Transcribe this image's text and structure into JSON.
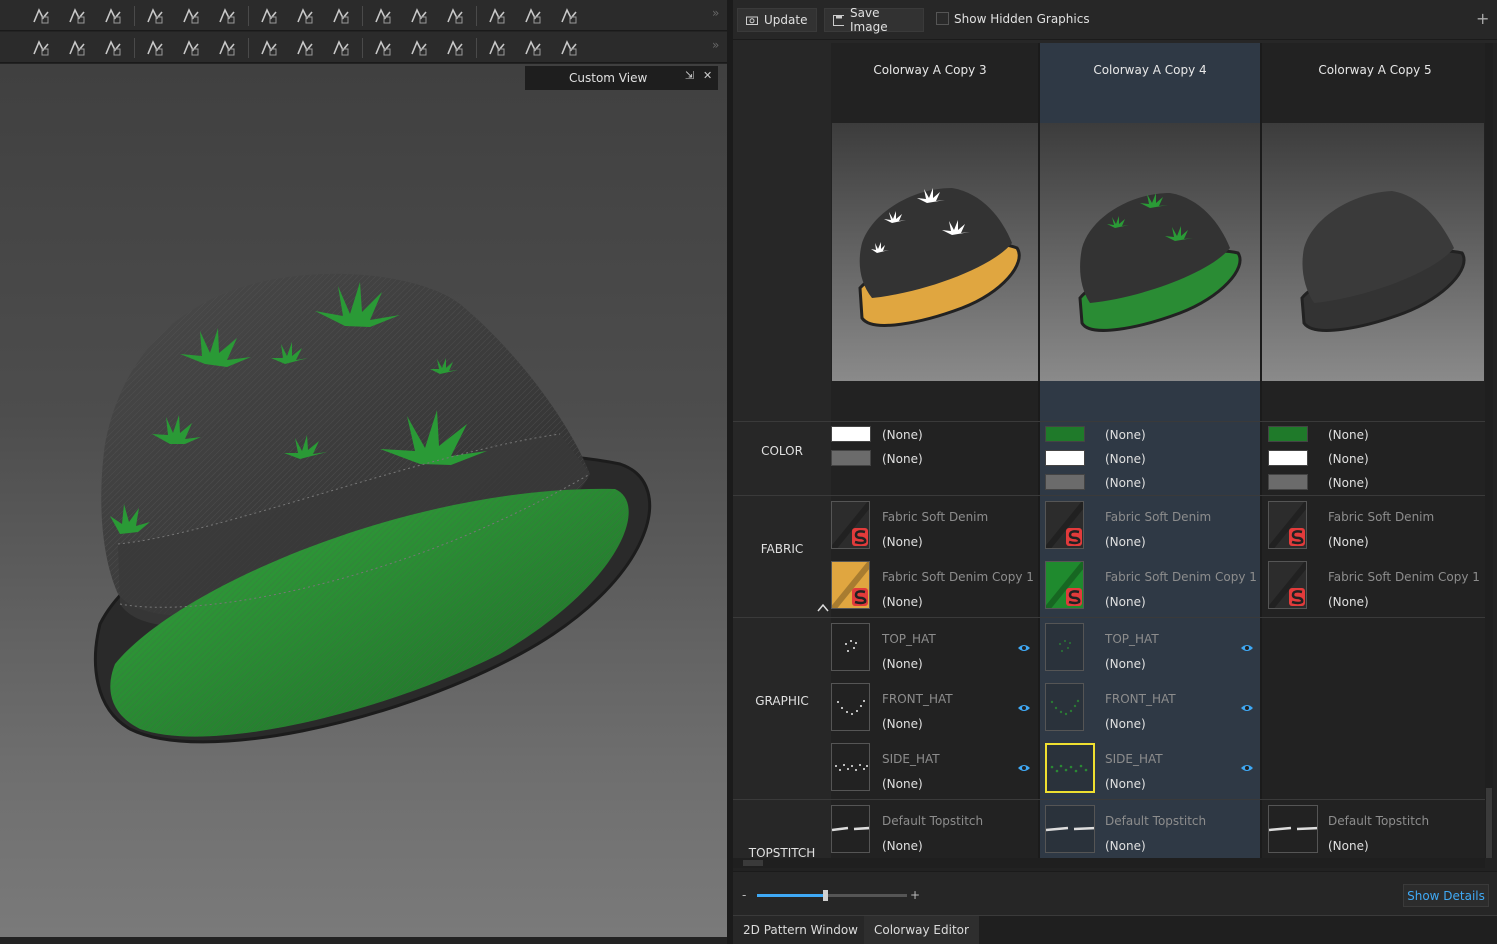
{
  "toolbar": {
    "row1_icons": [
      "select-mesh-icon",
      "transform-icon",
      "simulate-garment-icon",
      "sewing-segment-icon",
      "sewing-free-icon",
      "sewing-multi-icon",
      "tack-icon",
      "pin-icon",
      "brush-icon",
      "fold-arrange-icon",
      "fold-icon",
      "avatar-arrange-icon",
      "arrange-point-icon",
      "arrange-bar-icon",
      "avatar-select-icon"
    ],
    "row2_icons": [
      "edit-pattern-icon",
      "edit-curve-icon",
      "edit-point-icon",
      "segment-sewing-icon",
      "free-sewing-icon",
      "fold-tool-icon",
      "topstitch-icon",
      "pipe-icon",
      "button-icon",
      "buttonhole-icon",
      "zipper-icon",
      "puckering-icon",
      "shirring-icon",
      "texture-edit-icon",
      "texture-transform-icon"
    ],
    "more_glyph": "»"
  },
  "viewport": {
    "title": "Custom View",
    "dock_glyph": "⇲",
    "close_glyph": "✕"
  },
  "panel_toolbar": {
    "update_label": "Update",
    "save_image_label": "Save Image",
    "show_hidden_label": "Show Hidden Graphics",
    "show_hidden_checked": false,
    "add_glyph": "+"
  },
  "colorways": [
    {
      "name": "Colorway A Copy 3",
      "selected": false,
      "color_swatches": [
        {
          "hex": "#ffffff",
          "label": "(None)"
        },
        {
          "hex": "#6b6b6b",
          "label": "(None)"
        }
      ],
      "fabrics": [
        {
          "name": "Fabric Soft Denim",
          "value": "(None)",
          "hex": "#2c2c2c"
        },
        {
          "name": "Fabric Soft Denim Copy 1",
          "value": "(None)",
          "hex": "#e0a640"
        }
      ],
      "graphics": [
        {
          "name": "TOP_HAT",
          "value": "(None)"
        },
        {
          "name": "FRONT_HAT",
          "value": "(None)"
        },
        {
          "name": "SIDE_HAT",
          "value": "(None)"
        }
      ],
      "topstitch": {
        "name": "Default Topstitch",
        "value": "(None)"
      },
      "leaf_hex": "#ffffff",
      "lining_hex": "#e0a640"
    },
    {
      "name": "Colorway A Copy 4",
      "selected": true,
      "color_swatches": [
        {
          "hex": "#1f7a2a",
          "label": "(None)"
        },
        {
          "hex": "#ffffff",
          "label": "(None)"
        },
        {
          "hex": "#6b6b6b",
          "label": "(None)"
        }
      ],
      "fabrics": [
        {
          "name": "Fabric Soft Denim",
          "value": "(None)",
          "hex": "#2c2c2c"
        },
        {
          "name": "Fabric Soft Denim Copy 1",
          "value": "(None)",
          "hex": "#1f8a2e"
        }
      ],
      "graphics": [
        {
          "name": "TOP_HAT",
          "value": "(None)"
        },
        {
          "name": "FRONT_HAT",
          "value": "(None)"
        },
        {
          "name": "SIDE_HAT",
          "value": "(None)"
        }
      ],
      "topstitch": {
        "name": "Default Topstitch",
        "value": "(None)"
      },
      "leaf_hex": "#2a9a36",
      "lining_hex": "#2a8c34"
    },
    {
      "name": "Colorway A Copy 5",
      "selected": false,
      "color_swatches": [
        {
          "hex": "#1f7a2a",
          "label": "(None)"
        },
        {
          "hex": "#ffffff",
          "label": "(None)"
        },
        {
          "hex": "#6b6b6b",
          "label": "(None)"
        }
      ],
      "fabrics": [
        {
          "name": "Fabric Soft Denim",
          "value": "(None)",
          "hex": "#2c2c2c"
        },
        {
          "name": "Fabric Soft Denim Copy 1",
          "value": "(None)",
          "hex": "#2c2c2c"
        }
      ],
      "graphics": [],
      "topstitch": {
        "name": "Default Topstitch",
        "value": "(None)"
      },
      "leaf_hex": "#333333",
      "lining_hex": "#333333"
    }
  ],
  "row_labels": {
    "color": "COLOR",
    "fabric": "FABRIC",
    "graphic": "GRAPHIC",
    "topstitch": "TOPSTITCH"
  },
  "zoom_slider": {
    "minus": "-",
    "plus": "+",
    "value": 0.45
  },
  "show_details_label": "Show Details",
  "bottom_tabs": [
    {
      "label": "2D Pattern Window",
      "active": false
    },
    {
      "label": "Colorway Editor",
      "active": true
    }
  ],
  "colors": {
    "accent": "#3fa9f5",
    "selected_column": "#2f3945",
    "highlight_border": "#f0e030"
  }
}
